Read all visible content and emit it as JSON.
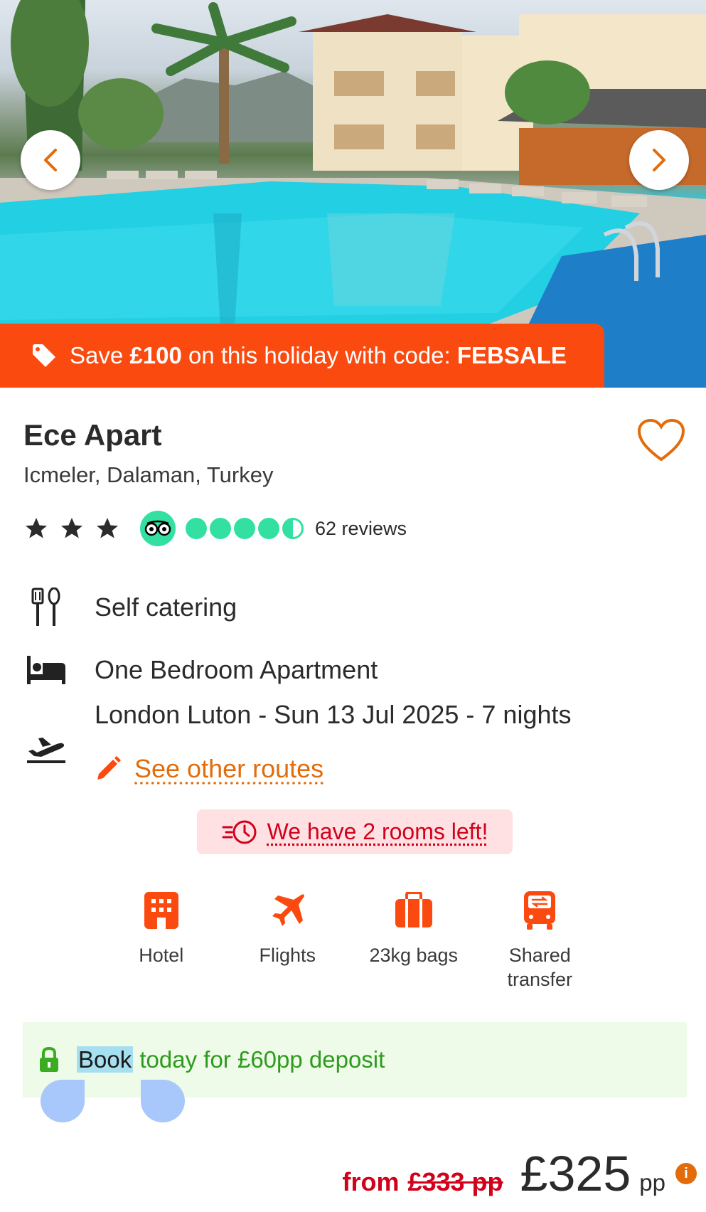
{
  "hotel": {
    "name": "Ece Apart",
    "location": "Icmeler, Dalaman, Turkey",
    "star_rating": 3,
    "tripadvisor_bubbles": 4.5,
    "reviews_label": "62 reviews"
  },
  "promo": {
    "prefix": "Save ",
    "amount": "£100",
    "middle": " on this holiday with code: ",
    "code": "FEBSALE"
  },
  "features": {
    "board": "Self catering",
    "room": "One Bedroom Apartment",
    "flight": "London Luton - Sun 13 Jul 2025 - 7 nights",
    "routes_link": "See other routes"
  },
  "urgency": {
    "text": "We have 2 rooms left!"
  },
  "inclusions": [
    {
      "icon": "hotel-icon",
      "label": "Hotel"
    },
    {
      "icon": "plane-icon",
      "label": "Flights"
    },
    {
      "icon": "luggage-icon",
      "label": "23kg bags"
    },
    {
      "icon": "bus-icon",
      "label": "Shared transfer"
    }
  ],
  "deposit": {
    "highlighted": "Book",
    "rest": " today for £60pp deposit"
  },
  "price": {
    "from_label": "from",
    "old_price": "£333 pp",
    "current_price": "£325",
    "per_person": "pp"
  },
  "colors": {
    "brand_orange": "#fa4a0f",
    "link_orange": "#e36c0a",
    "tripadvisor_green": "#34e0a1",
    "urgency_red": "#d0021b",
    "deposit_green": "#2e9b1e"
  }
}
